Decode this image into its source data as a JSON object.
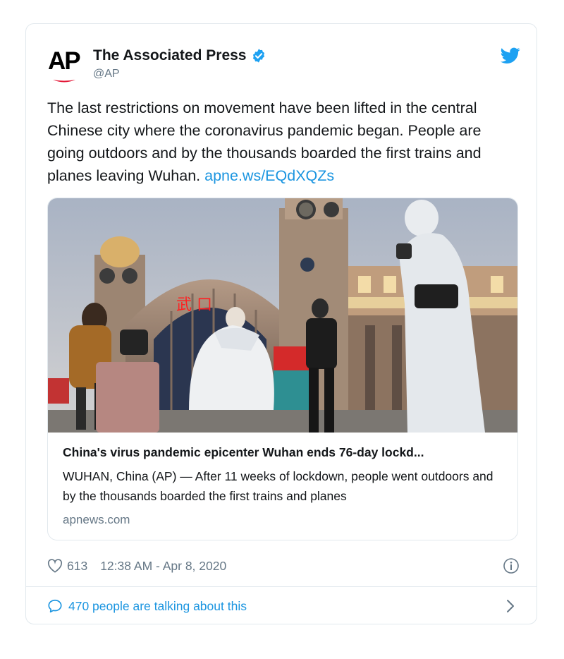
{
  "account": {
    "logo_text": "AP",
    "name": "The Associated Press",
    "handle": "@AP",
    "verified": true
  },
  "tweet": {
    "text": "The last restrictions on movement have been lifted in the central Chinese city where the coronavirus pandemic began. People are going outdoors and by the thousands boarded the first trains and planes leaving Wuhan. ",
    "link": "apne.ws/EQdXQZs"
  },
  "link_card": {
    "title": "China's virus pandemic epicenter Wuhan ends 76-day lockd...",
    "description": "WUHAN, China (AP) — After 11 weeks of lockdown, people went outdoors and by the thousands boarded the first trains and planes",
    "domain": "apnews.com",
    "photo_signs": [
      "武 口"
    ]
  },
  "meta": {
    "likes": "613",
    "timestamp": "12:38 AM - Apr 8, 2020"
  },
  "talk": {
    "label": "470 people are talking about this"
  },
  "colors": {
    "accent": "#1b95e0",
    "muted": "#657786",
    "text": "#14171a",
    "border": "#e1e8ed",
    "ap_red": "#e31837"
  },
  "icons": [
    "verified-badge-icon",
    "twitter-bird-icon",
    "heart-icon",
    "info-icon",
    "comment-bubble-icon",
    "chevron-right-icon"
  ]
}
